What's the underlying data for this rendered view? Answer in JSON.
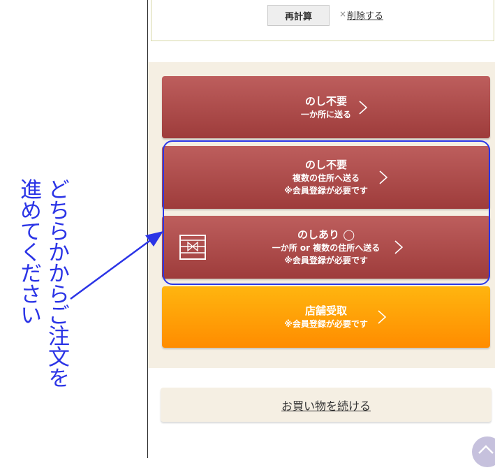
{
  "cart": {
    "recalc_label": "再計算",
    "delete_prefix": "×",
    "delete_label": "削除する"
  },
  "order_options": [
    {
      "title": "のし不要",
      "lines": [
        "一か所に送る"
      ]
    },
    {
      "title": "のし不要",
      "lines": [
        "複数の住所へ送る",
        "※会員登録が必要です"
      ]
    },
    {
      "title": "のしあり ◯",
      "lines": [
        "一か所 or 複数の住所へ送る",
        "※会員登録が必要です"
      ]
    },
    {
      "title": "店舗受取",
      "lines": [
        "※会員登録が必要です"
      ]
    }
  ],
  "continue_shopping": "お買い物を続ける",
  "annotation": {
    "col1": "どちらかからご注文を",
    "col2": "進めてください",
    "color": "#2b34e6"
  },
  "icons": {
    "chevron": "chevron-right-icon",
    "gift": "noshi-gift-icon",
    "scroll_top": "chevron-up-icon"
  },
  "colors": {
    "red_button": "#b0504f",
    "orange_button": "#ff9d08",
    "panel_bg": "#f5efe3"
  }
}
